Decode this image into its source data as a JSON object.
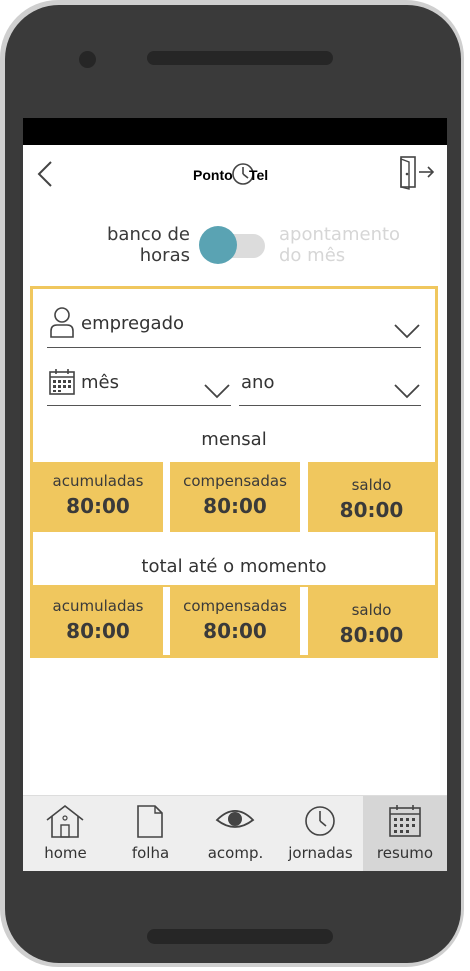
{
  "header": {
    "logo_left": "Ponto",
    "logo_right": "Tel"
  },
  "toggle": {
    "left_line1": "banco de",
    "left_line2": "horas",
    "right_line1": "apontamento",
    "right_line2": "do mês",
    "state": "off"
  },
  "filters": {
    "employee_label": "empregado",
    "month_label": "mês",
    "year_label": "ano"
  },
  "monthly": {
    "title": "mensal",
    "cells": [
      {
        "label": "acumuladas",
        "value": "80:00"
      },
      {
        "label": "compensadas",
        "value": "80:00"
      },
      {
        "label": "saldo",
        "value": "80:00"
      }
    ]
  },
  "total": {
    "title": "total até o momento",
    "cells": [
      {
        "label": "acumuladas",
        "value": "80:00"
      },
      {
        "label": "compensadas",
        "value": "80:00"
      },
      {
        "label": "saldo",
        "value": "80:00"
      }
    ]
  },
  "nav": {
    "items": [
      {
        "label": "home",
        "icon": "home-icon"
      },
      {
        "label": "folha",
        "icon": "document-icon"
      },
      {
        "label": "acomp.",
        "icon": "eye-icon"
      },
      {
        "label": "jornadas",
        "icon": "clock-icon"
      },
      {
        "label": "resumo",
        "icon": "calendar-icon"
      }
    ],
    "active": "resumo"
  },
  "colors": {
    "accent_yellow": "#f0c75e",
    "toggle_knob": "#5aa3b3",
    "text_dark": "#3a3a3a",
    "inactive_text": "#d6d6d6"
  }
}
